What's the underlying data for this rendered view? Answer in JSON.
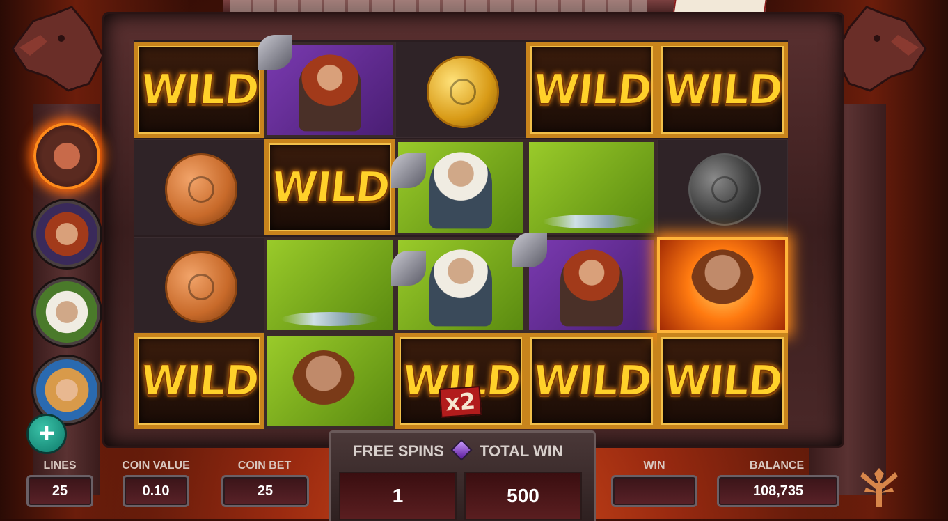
{
  "reels": [
    [
      {
        "type": "wild",
        "label": "WILD"
      },
      {
        "type": "coin",
        "variant": "bronze"
      },
      {
        "type": "coin",
        "variant": "bronze"
      },
      {
        "type": "wild",
        "label": "WILD"
      }
    ],
    [
      {
        "type": "character",
        "bg": "purple",
        "who": "red-beard-axe"
      },
      {
        "type": "wild",
        "label": "WILD"
      },
      {
        "type": "character",
        "bg": "green",
        "who": "splash-hand"
      },
      {
        "type": "character",
        "bg": "green",
        "who": "rider"
      }
    ],
    [
      {
        "type": "coin",
        "variant": "gold"
      },
      {
        "type": "character",
        "bg": "green",
        "who": "white-beard-axe"
      },
      {
        "type": "character",
        "bg": "green",
        "who": "white-beard-axe"
      },
      {
        "type": "wild",
        "label": "WILD",
        "multiplier": "x2"
      }
    ],
    [
      {
        "type": "wild",
        "label": "WILD"
      },
      {
        "type": "character",
        "bg": "green",
        "who": "splash-hand"
      },
      {
        "type": "character",
        "bg": "purple",
        "who": "red-beard-axe"
      },
      {
        "type": "wild",
        "label": "WILD"
      }
    ],
    [
      {
        "type": "wild",
        "label": "WILD"
      },
      {
        "type": "coin",
        "variant": "silver"
      },
      {
        "type": "character",
        "bg": "fire",
        "who": "fist"
      },
      {
        "type": "wild",
        "label": "WILD"
      }
    ]
  ],
  "portraits": [
    "fire-chief",
    "red-beard",
    "white-beard",
    "blonde-shieldmaiden"
  ],
  "controls": {
    "lines_label": "LINES",
    "lines_value": "25",
    "coin_value_label": "COIN VALUE",
    "coin_value": "0.10",
    "coin_bet_label": "COIN BET",
    "coin_bet_value": "25",
    "free_spins_label": "FREE SPINS",
    "free_spins_value": "1",
    "total_win_label": "TOTAL WIN",
    "total_win_value": "500",
    "win_label": "WIN",
    "win_value": "",
    "balance_label": "BALANCE",
    "balance_value": "108,735",
    "plus_symbol": "+"
  },
  "colors": {
    "wild_gold": "#ffd12a",
    "frame": "#c8841c",
    "purple_bg": "#7a3ab0",
    "green_bg": "#9acb2a"
  }
}
